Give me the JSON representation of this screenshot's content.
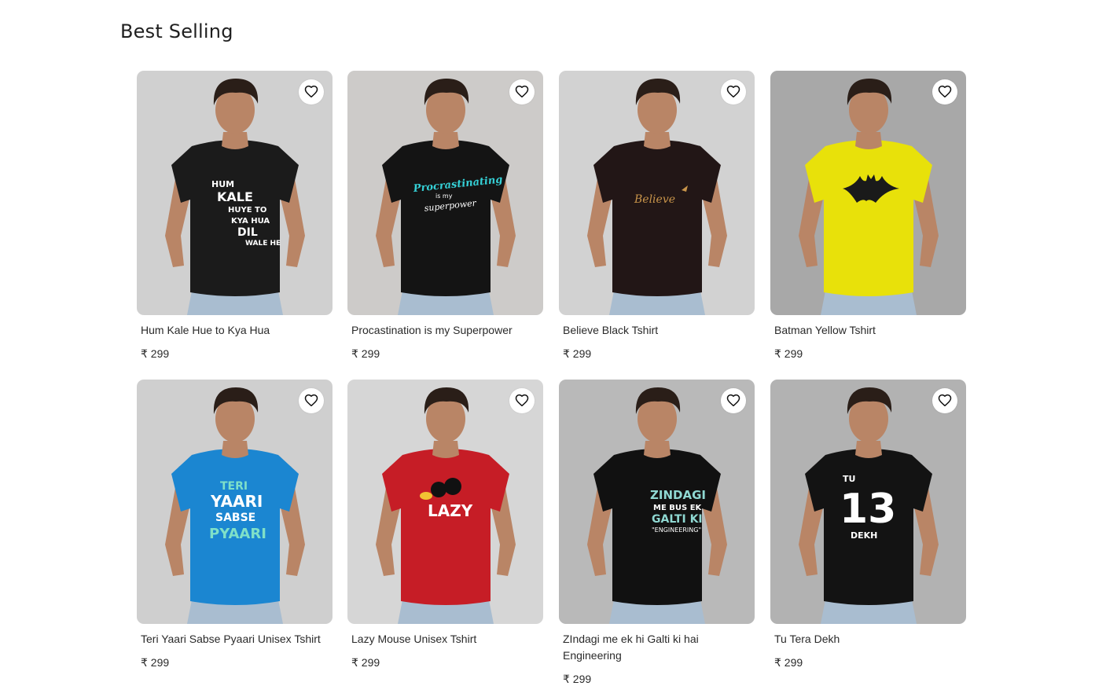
{
  "section": {
    "title": "Best Selling"
  },
  "currency": "₹",
  "products": [
    {
      "name": "Hum Kale Hue to Kya Hua",
      "price": "₹ 299",
      "bg": "#d0d0d0",
      "shirt": "#1b1b1b",
      "print": [
        "HUM",
        "KALE",
        "HUYE TO",
        "KYA HUA",
        "DIL",
        "WALE HE"
      ],
      "print_color": "#ffffff"
    },
    {
      "name": "Procastination is my Superpower",
      "price": "₹ 299",
      "bg": "#cdcbc9",
      "shirt": "#141414",
      "print": [
        "Procrastinating",
        "is my",
        "superpower"
      ],
      "print_color": "#35d0d6"
    },
    {
      "name": "Believe Black Tshirt",
      "price": "₹ 299",
      "bg": "#d2d2d2",
      "shirt": "#221616",
      "print": [
        "Believe"
      ],
      "print_color": "#c8944a"
    },
    {
      "name": "Batman Yellow Tshirt",
      "price": "₹ 299",
      "bg": "#a8a8a8",
      "shirt": "#e8e10a",
      "print": [],
      "print_color": "#1a1a1a"
    },
    {
      "name": "Teri Yaari Sabse Pyaari Unisex Tshirt",
      "price": "₹ 299",
      "bg": "#cfcfcf",
      "shirt": "#1b86d1",
      "print": [
        "TERI",
        "YAARI",
        "SABSE",
        "PYAARI"
      ],
      "print_color": "#ffffff"
    },
    {
      "name": "Lazy Mouse Unisex Tshirt",
      "price": "₹ 299",
      "bg": "#d6d6d6",
      "shirt": "#c61d26",
      "print": [
        "LAZY"
      ],
      "print_color": "#ffffff"
    },
    {
      "name": "ZIndagi me ek hi Galti ki hai Engineering",
      "price": "₹ 299",
      "bg": "#b9b9b9",
      "shirt": "#111111",
      "print": [
        "ZINDAGI",
        "ME BUS EK",
        "GALTI KI",
        "\"ENGINEERING\""
      ],
      "print_color": "#8fd8d2"
    },
    {
      "name": "Tu Tera Dekh",
      "price": "₹ 299",
      "bg": "#b2b2b2",
      "shirt": "#131313",
      "print": [
        "TU",
        "13",
        "DEKH"
      ],
      "print_color": "#ffffff"
    }
  ],
  "icons": {
    "wishlist": "heart-outline-icon"
  }
}
